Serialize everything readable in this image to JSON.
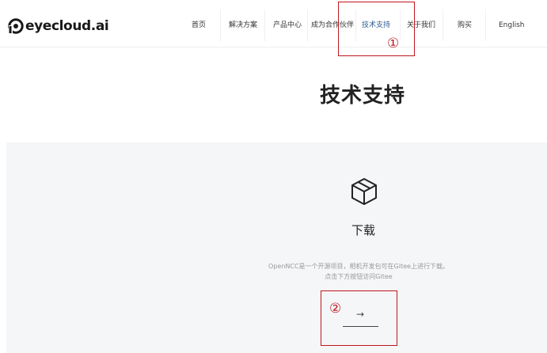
{
  "header": {
    "logo_text": "eyecloud.ai",
    "nav": [
      {
        "label": "首页"
      },
      {
        "label": "解决方案"
      },
      {
        "label": "产品中心"
      },
      {
        "label": "成为合作伙伴"
      },
      {
        "label": "技术支持",
        "active": true
      },
      {
        "label": "关于我们"
      },
      {
        "label": "购买"
      },
      {
        "label": "English"
      }
    ]
  },
  "main": {
    "title": "技术支持",
    "download": {
      "icon": "box-icon",
      "title": "下载",
      "desc_line1": "OpenNCC是一个开源项目，相机开发包可在Gitee上进行下载。",
      "desc_line2": "点击下方按钮访问Gitee",
      "arrow": "→"
    }
  },
  "annotations": {
    "label1": "①",
    "label2": "②",
    "color": "#c0161f"
  },
  "colors": {
    "active_nav": "#2f5a8f",
    "panel_bg": "#f5f6f7"
  }
}
